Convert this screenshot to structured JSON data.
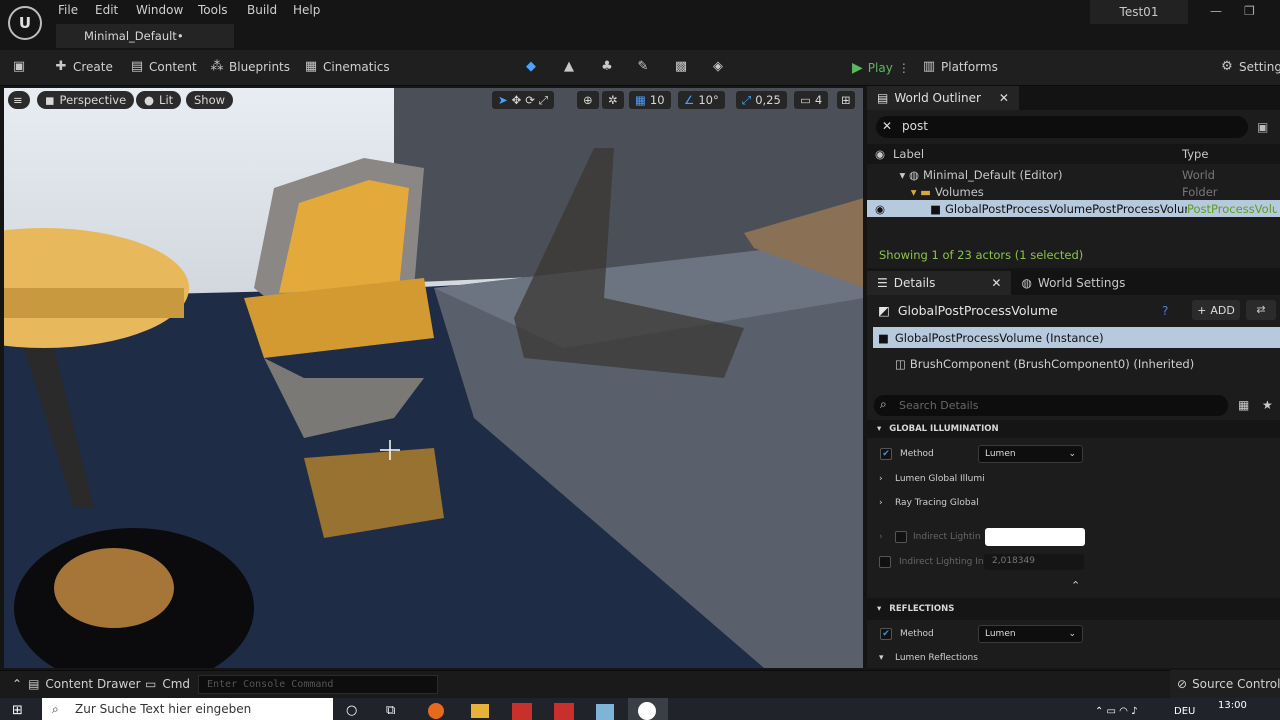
{
  "menu": [
    "File",
    "Edit",
    "Window",
    "Tools",
    "Build",
    "Help"
  ],
  "document_tab": "Minimal_Default•",
  "project_name": "Test01",
  "toolbar": {
    "create": "Create",
    "content": "Content",
    "blueprints": "Blueprints",
    "cinematics": "Cinematics",
    "play": "Play",
    "platforms": "Platforms",
    "settings": "Settings"
  },
  "viewport": {
    "perspective": "Perspective",
    "lit": "Lit",
    "show": "Show",
    "grid_snap": "10",
    "rotation_snap": "10°",
    "scale_snap": "0,25",
    "camera_speed": "4"
  },
  "outliner": {
    "tab": "World Outliner",
    "search_value": "post",
    "col_label": "Label",
    "col_type": "Type",
    "rows": [
      {
        "label": "Minimal_Default (Editor)",
        "type": "World"
      },
      {
        "label": "Volumes",
        "type": "Folder"
      },
      {
        "label": "GlobalPostProcessVolumePostProcessVolume",
        "type": "PostProcessVolume"
      }
    ],
    "status": "Showing 1 of 23 actors (1 selected)"
  },
  "details": {
    "tab": "Details",
    "tab2": "World Settings",
    "actor_name": "GlobalPostProcessVolume",
    "add_label": "ADD",
    "instance_row": "GlobalPostProcessVolume  (Instance)",
    "component_row": "BrushComponent (BrushComponent0) (Inherited)",
    "search_placeholder": "Search Details",
    "section_gi": "GLOBAL ILLUMINATION",
    "method_label": "Method",
    "method_value": "Lumen",
    "lumen_gi": "Lumen Global Illumi",
    "ray_tracing": "Ray Tracing Global",
    "indirect_lighting": "Indirect Lightin",
    "indirect_intensity": "Indirect Lighting In",
    "indirect_intensity_value": "2,018349",
    "section_reflections": "REFLECTIONS",
    "refl_method_label": "Method",
    "refl_method_value": "Lumen",
    "lumen_reflections": "Lumen Reflections"
  },
  "bottombar": {
    "content_drawer": "Content Drawer",
    "cmd": "Cmd",
    "console_placeholder": "Enter Console Command",
    "source_control": "Source Control C"
  },
  "taskbar": {
    "search_placeholder": "Zur Suche Text hier eingeben",
    "language": "DEU",
    "time": "13:00"
  },
  "colors": {
    "accent_blue": "#3c8fdc",
    "play_green": "#5cb85c",
    "status_green": "#8bc34a",
    "highlight_green": "#9ad33a",
    "selected_row": "#b7c9dc"
  }
}
